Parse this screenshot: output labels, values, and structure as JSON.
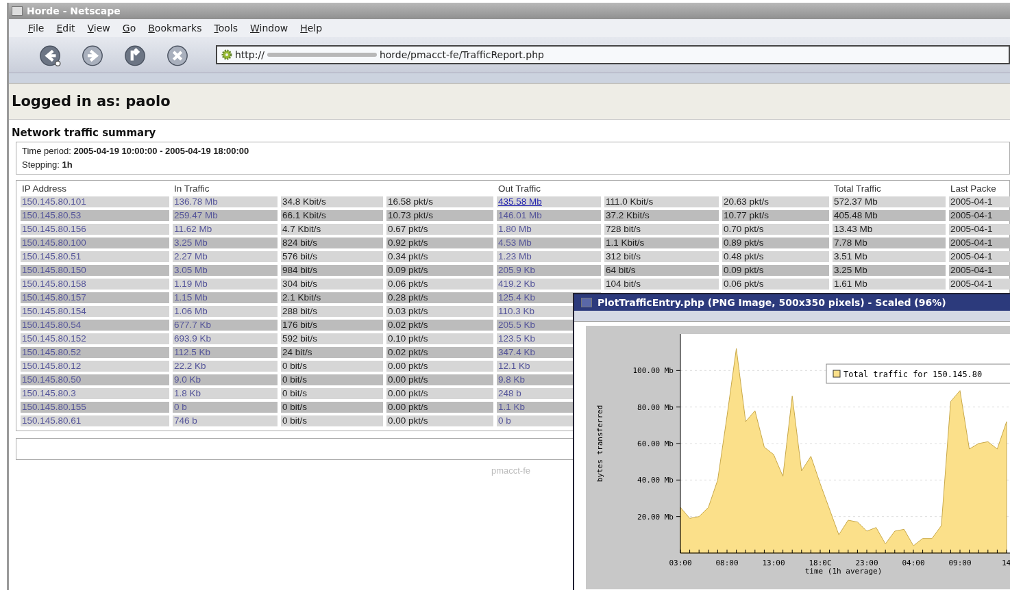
{
  "window": {
    "title": "Horde - Netscape"
  },
  "menu": [
    "File",
    "Edit",
    "View",
    "Go",
    "Bookmarks",
    "Tools",
    "Window",
    "Help"
  ],
  "nav_buttons": [
    {
      "kind": "back",
      "disabled": false
    },
    {
      "kind": "forward",
      "disabled": true
    },
    {
      "kind": "reload",
      "disabled": false
    },
    {
      "kind": "stop",
      "disabled": true
    }
  ],
  "address": {
    "scheme": "http://",
    "path": "horde/pmacct-fe/TrafficReport.php"
  },
  "login": "Logged in as: paolo",
  "section_title": "Network traffic summary",
  "period": {
    "label": "Time period:",
    "value": "2005-04-19 10:00:00 - 2005-04-19 18:00:00",
    "step_label": "Stepping:",
    "step_value": "1h"
  },
  "table": {
    "columns": {
      "ip": "IP Address",
      "in": "In Traffic",
      "out": "Out Traffic",
      "total": "Total Traffic",
      "last": "Last Packe"
    },
    "rows": [
      {
        "ip": "150.145.80.101",
        "in": {
          "bytes": "136.78 Mb",
          "bits": "34.8 Kbit/s",
          "pkts": "16.58 pkt/s"
        },
        "out": {
          "bytes": "435.58 Mb",
          "bits": "111.0 Kbit/s",
          "pkts": "20.63 pkt/s"
        },
        "total": "572.37 Mb",
        "last": "2005-04-1",
        "hovered": true
      },
      {
        "ip": "150.145.80.53",
        "in": {
          "bytes": "259.47 Mb",
          "bits": "66.1 Kbit/s",
          "pkts": "10.73 pkt/s"
        },
        "out": {
          "bytes": "146.01 Mb",
          "bits": "37.2 Kbit/s",
          "pkts": "10.77 pkt/s"
        },
        "total": "405.48 Mb",
        "last": "2005-04-1",
        "hovered": false
      },
      {
        "ip": "150.145.80.156",
        "in": {
          "bytes": "11.62 Mb",
          "bits": "4.7 Kbit/s",
          "pkts": "0.67 pkt/s"
        },
        "out": {
          "bytes": "1.80 Mb",
          "bits": "728 bit/s",
          "pkts": "0.70 pkt/s"
        },
        "total": "13.43 Mb",
        "last": "2005-04-1",
        "hovered": false
      },
      {
        "ip": "150.145.80.100",
        "in": {
          "bytes": "3.25 Mb",
          "bits": "824 bit/s",
          "pkts": "0.92 pkt/s"
        },
        "out": {
          "bytes": "4.53 Mb",
          "bits": "1.1 Kbit/s",
          "pkts": "0.89 pkt/s"
        },
        "total": "7.78 Mb",
        "last": "2005-04-1",
        "hovered": false
      },
      {
        "ip": "150.145.80.51",
        "in": {
          "bytes": "2.27 Mb",
          "bits": "576 bit/s",
          "pkts": "0.34 pkt/s"
        },
        "out": {
          "bytes": "1.23 Mb",
          "bits": "312 bit/s",
          "pkts": "0.48 pkt/s"
        },
        "total": "3.51 Mb",
        "last": "2005-04-1",
        "hovered": false
      },
      {
        "ip": "150.145.80.150",
        "in": {
          "bytes": "3.05 Mb",
          "bits": "984 bit/s",
          "pkts": "0.09 pkt/s"
        },
        "out": {
          "bytes": "205.9 Kb",
          "bits": "64 bit/s",
          "pkts": "0.09 pkt/s"
        },
        "total": "3.25 Mb",
        "last": "2005-04-1",
        "hovered": false
      },
      {
        "ip": "150.145.80.158",
        "in": {
          "bytes": "1.19 Mb",
          "bits": "304 bit/s",
          "pkts": "0.06 pkt/s"
        },
        "out": {
          "bytes": "419.2 Kb",
          "bits": "104 bit/s",
          "pkts": "0.06 pkt/s"
        },
        "total": "1.61 Mb",
        "last": "2005-04-1",
        "hovered": false
      },
      {
        "ip": "150.145.80.157",
        "in": {
          "bytes": "1.15 Mb",
          "bits": "2.1 Kbit/s",
          "pkts": "0.28 pkt/s"
        },
        "out": {
          "bytes": "125.4 Kb"
        },
        "hovered": false
      },
      {
        "ip": "150.145.80.154",
        "in": {
          "bytes": "1.06 Mb",
          "bits": "288 bit/s",
          "pkts": "0.03 pkt/s"
        },
        "out": {
          "bytes": "110.3 Kb"
        },
        "hovered": false
      },
      {
        "ip": "150.145.80.54",
        "in": {
          "bytes": "677.7 Kb",
          "bits": "176 bit/s",
          "pkts": "0.02 pkt/s"
        },
        "out": {
          "bytes": "205.5 Kb"
        },
        "hovered": false
      },
      {
        "ip": "150.145.80.152",
        "in": {
          "bytes": "693.9 Kb",
          "bits": "592 bit/s",
          "pkts": "0.10 pkt/s"
        },
        "out": {
          "bytes": "123.5 Kb"
        },
        "hovered": false
      },
      {
        "ip": "150.145.80.52",
        "in": {
          "bytes": "112.5 Kb",
          "bits": "24 bit/s",
          "pkts": "0.02 pkt/s"
        },
        "out": {
          "bytes": "347.4 Kb"
        },
        "hovered": false
      },
      {
        "ip": "150.145.80.12",
        "in": {
          "bytes": "22.2 Kb",
          "bits": "0 bit/s",
          "pkts": "0.00 pkt/s"
        },
        "out": {
          "bytes": "12.1 Kb"
        },
        "hovered": false
      },
      {
        "ip": "150.145.80.50",
        "in": {
          "bytes": "9.0 Kb",
          "bits": "0 bit/s",
          "pkts": "0.00 pkt/s"
        },
        "out": {
          "bytes": "9.8 Kb"
        },
        "hovered": false
      },
      {
        "ip": "150.145.80.3",
        "in": {
          "bytes": "1.8 Kb",
          "bits": "0 bit/s",
          "pkts": "0.00 pkt/s"
        },
        "out": {
          "bytes": "248 b"
        },
        "hovered": false
      },
      {
        "ip": "150.145.80.155",
        "in": {
          "bytes": "0 b",
          "bits": "0 bit/s",
          "pkts": "0.00 pkt/s"
        },
        "out": {
          "bytes": "1.1 Kb"
        },
        "hovered": false
      },
      {
        "ip": "150.145.80.61",
        "in": {
          "bytes": "746 b",
          "bits": "0 bit/s",
          "pkts": "0.00 pkt/s"
        },
        "out": {
          "bytes": "0 b"
        },
        "hovered": false
      }
    ]
  },
  "footer": "pmacct-fe",
  "popup": {
    "title": "PlotTrafficEntry.php (PNG Image, 500x350 pixels) - Scaled (96%)",
    "chart_data": {
      "type": "area",
      "xlabel": "time (1h average)",
      "ylabel": "bytes transferred",
      "categories": [
        "03:00",
        null,
        null,
        null,
        null,
        "08:00",
        null,
        null,
        null,
        null,
        "13:00",
        null,
        null,
        null,
        null,
        "18:0C",
        null,
        null,
        null,
        null,
        "23:00",
        null,
        null,
        null,
        null,
        "04:00",
        null,
        null,
        null,
        null,
        "09:00",
        null,
        null,
        null,
        null,
        "14"
      ],
      "series": [
        {
          "name": "Total traffic for 150.145.80",
          "color": "#fbe08a",
          "values": [
            25,
            19,
            20,
            25,
            40,
            75,
            112,
            72,
            78,
            58,
            54,
            42,
            86,
            45,
            53,
            38,
            24,
            10,
            18,
            17,
            12,
            14,
            5,
            12,
            13,
            4,
            8,
            8,
            15,
            83,
            89,
            57,
            60,
            61,
            57,
            72
          ]
        }
      ],
      "ylim": [
        0,
        120
      ],
      "grid": true,
      "yticks": [
        {
          "value": 20,
          "label": "20.00 Mb"
        },
        {
          "value": 40,
          "label": "40.00 Mb"
        },
        {
          "value": 60,
          "label": "60.00 Mb"
        },
        {
          "value": 80,
          "label": "80.00 Mb"
        },
        {
          "value": 100,
          "label": "100.00 Mb"
        }
      ]
    }
  }
}
